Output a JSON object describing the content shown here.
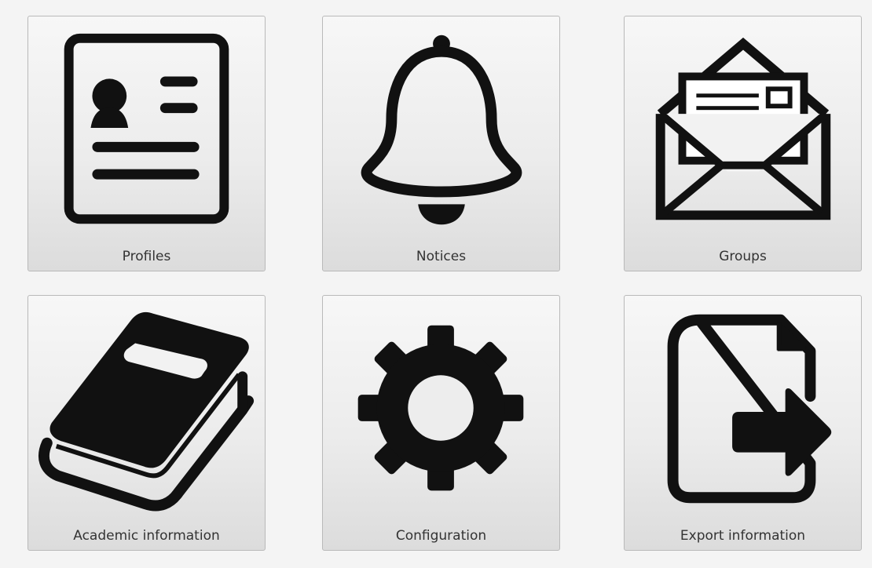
{
  "tiles": [
    {
      "id": "profiles",
      "label": "Profiles",
      "icon": "profile-card-icon"
    },
    {
      "id": "notices",
      "label": "Notices",
      "icon": "bell-icon"
    },
    {
      "id": "groups",
      "label": "Groups",
      "icon": "envelope-icon"
    },
    {
      "id": "academic",
      "label": "Academic information",
      "icon": "book-icon"
    },
    {
      "id": "config",
      "label": "Configuration",
      "icon": "gear-icon"
    },
    {
      "id": "export",
      "label": "Export information",
      "icon": "file-export-icon"
    }
  ],
  "colors": {
    "background": "#f4f4f4",
    "tile_border": "#b9b9b9",
    "icon": "#111111",
    "label": "#333333"
  }
}
